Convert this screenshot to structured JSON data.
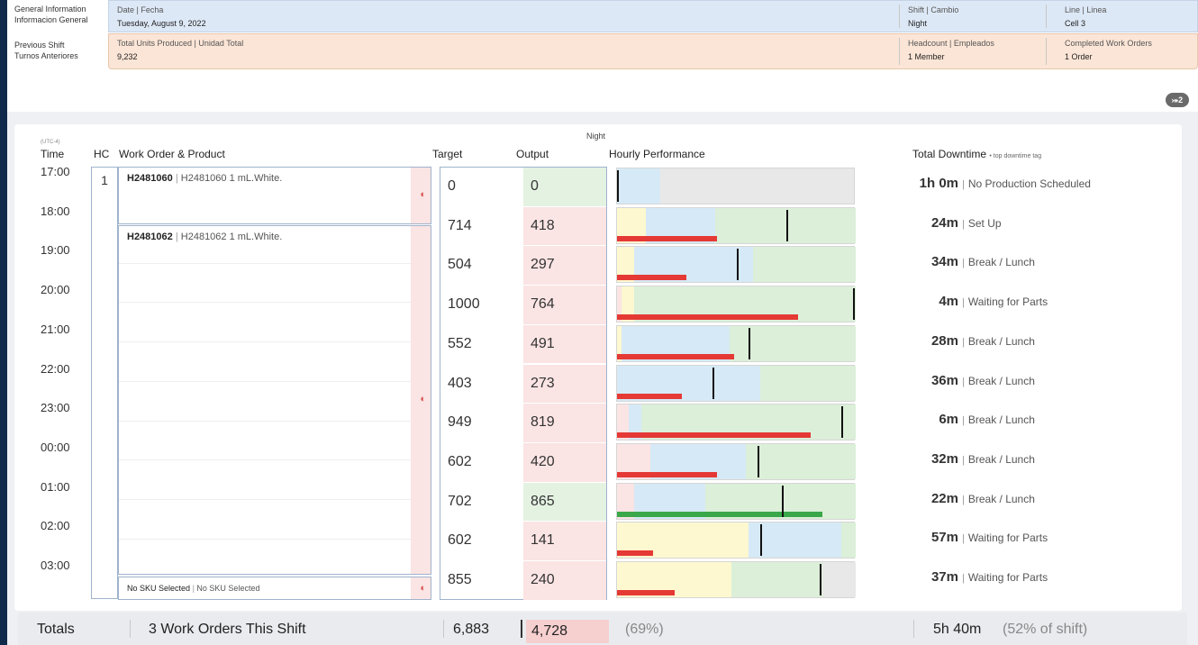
{
  "info": {
    "general_label_1": "General Information",
    "general_label_2": "Informacion General",
    "previous_label_1": "Previous Shift",
    "previous_label_2": "Turnos Anteriores",
    "date_label": "Date | Fecha",
    "date_value": "Tuesday, August 9, 2022",
    "shift_label": "Shift | Cambio",
    "shift_value": "Night",
    "line_label": "Line | Linea",
    "line_value": "Cell 3",
    "units_label": "Total Units Produced | Unidad Total",
    "units_value": "9,232",
    "headcount_label": "Headcount | Empleados",
    "headcount_value": "1 Member",
    "wo_label": "Completed Work Orders",
    "wo_value": "1 Order"
  },
  "filter_badge": "⤖2",
  "shift_name": "Night",
  "timezone": "(UTC-4)",
  "headers": {
    "time": "Time",
    "hc": "HC",
    "work_order": "Work Order & Product",
    "target": "Target",
    "output": "Output",
    "hourly": "Hourly Performance",
    "downtime": "Total Downtime",
    "downtime_sub": "• top downtime tag"
  },
  "hc_value": "1",
  "work_orders": [
    {
      "code": "H2481060",
      "sep": "|",
      "desc": "H2481060 1 mL.White."
    },
    {
      "code": "H2481062",
      "sep": "|",
      "desc": "H2481062 1 mL.White."
    },
    {
      "code": "No SKU Selected",
      "sep": "|",
      "desc": "No SKU Selected"
    }
  ],
  "timer_icon": "◐",
  "hours": [
    {
      "time": "17:00",
      "target": "0",
      "output": "0",
      "downtime": "1h 0m",
      "tag": "No Production Scheduled"
    },
    {
      "time": "18:00",
      "target": "714",
      "output": "418",
      "downtime": "24m",
      "tag": "Set Up"
    },
    {
      "time": "19:00",
      "target": "504",
      "output": "297",
      "downtime": "34m",
      "tag": "Break / Lunch"
    },
    {
      "time": "20:00",
      "target": "1000",
      "output": "764",
      "downtime": "4m",
      "tag": "Waiting for Parts"
    },
    {
      "time": "21:00",
      "target": "552",
      "output": "491",
      "downtime": "28m",
      "tag": "Break / Lunch"
    },
    {
      "time": "22:00",
      "target": "403",
      "output": "273",
      "downtime": "36m",
      "tag": "Break / Lunch"
    },
    {
      "time": "23:00",
      "target": "949",
      "output": "819",
      "downtime": "6m",
      "tag": "Break / Lunch"
    },
    {
      "time": "00:00",
      "target": "602",
      "output": "420",
      "downtime": "32m",
      "tag": "Break / Lunch"
    },
    {
      "time": "01:00",
      "target": "702",
      "output": "865",
      "downtime": "22m",
      "tag": "Break / Lunch"
    },
    {
      "time": "02:00",
      "target": "602",
      "output": "141",
      "downtime": "57m",
      "tag": "Waiting for Parts"
    },
    {
      "time": "03:00",
      "target": "855",
      "output": "240",
      "downtime": "37m",
      "tag": "Waiting for Parts"
    }
  ],
  "totals": {
    "label": "Totals",
    "work_orders": "3 Work Orders This Shift",
    "target": "6,883",
    "output": "4,728",
    "output_pct": "(69%)",
    "downtime": "5h 40m",
    "downtime_pct": "(52% of shift)"
  },
  "colors": {
    "good": "#dcefd9",
    "bad": "#fbe4e4",
    "idle": "#d6e9f6",
    "setup": "#fdf8cf",
    "red_bar": "#e53935",
    "green_bar": "#3aa84a"
  }
}
